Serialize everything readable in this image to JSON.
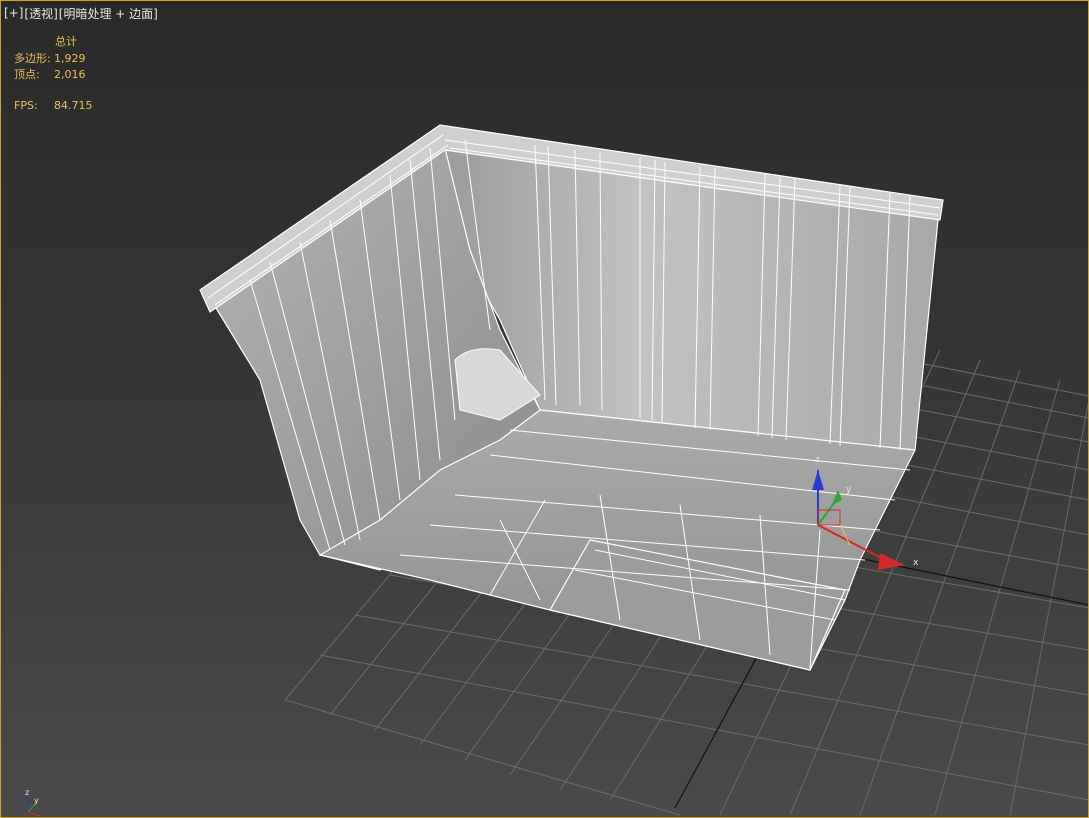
{
  "viewport": {
    "label_parts": [
      "[+]",
      "[透视]",
      "[明暗处理 + 边面]"
    ]
  },
  "stats": {
    "header": "总计",
    "polygons_label": "多边形:",
    "polygons_value": "1,929",
    "vertices_label": "顶点:",
    "vertices_value": "2,016",
    "fps_label": "FPS:",
    "fps_value": "84.715"
  },
  "gizmo": {
    "x_label": "x",
    "y_label": "y",
    "z_label": "z"
  },
  "colors": {
    "border": "#c9a227",
    "stats_text": "#e8c15a",
    "axis_x": "#d42a2a",
    "axis_y": "#2fa82f",
    "axis_z": "#2a3bd4",
    "grid": "#6a6a6a",
    "wire": "#ffffff"
  }
}
